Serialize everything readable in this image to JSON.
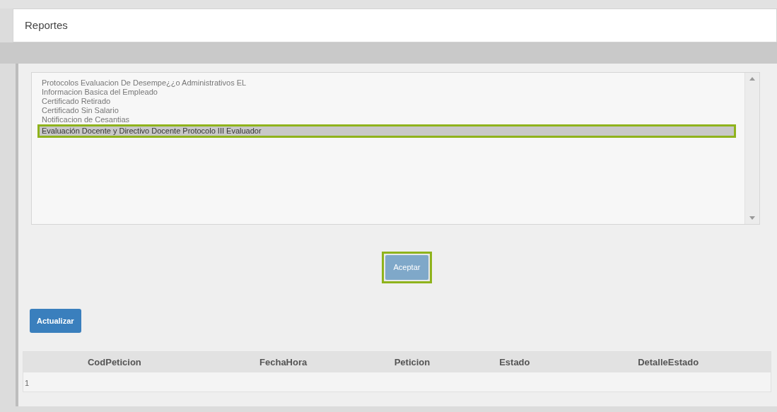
{
  "header": {
    "title": "Reportes"
  },
  "report_list": {
    "items": [
      {
        "label": "Protocolos Evaluacion De Desempe¿¿o Administrativos EL",
        "selected": false
      },
      {
        "label": "Informacion Basica del Empleado",
        "selected": false
      },
      {
        "label": "Certificado Retirado",
        "selected": false
      },
      {
        "label": "Certificado Sin Salario",
        "selected": false
      },
      {
        "label": "Notificacion de Cesantias",
        "selected": false
      },
      {
        "label": "Evaluación Docente y Directivo Docente Protocolo III Evaluador",
        "selected": true
      }
    ]
  },
  "accept_button": {
    "label": "Aceptar",
    "highlighted": true
  },
  "refresh_button": {
    "label": "Actualizar"
  },
  "table": {
    "columns": [
      "CodPeticion",
      "FechaHora",
      "Peticion",
      "Estado",
      "DetalleEstado"
    ],
    "rows": [
      [
        "1"
      ]
    ]
  }
}
